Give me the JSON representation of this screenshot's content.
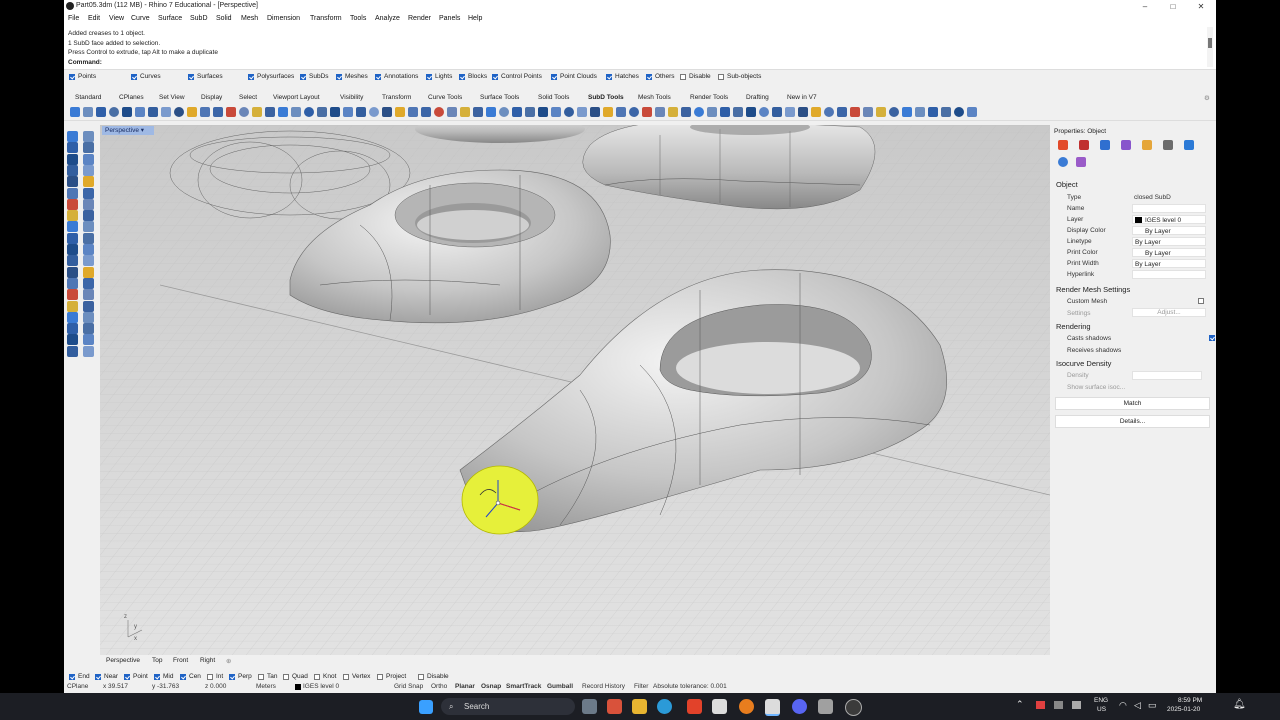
{
  "window": {
    "title": "Part05.3dm (112 MB) - Rhino 7 Educational - [Perspective]",
    "minimize": "–",
    "maximize": "□",
    "close": "✕"
  },
  "menu": [
    "File",
    "Edit",
    "View",
    "Curve",
    "Surface",
    "SubD",
    "Solid",
    "Mesh",
    "Dimension",
    "Transform",
    "Tools",
    "Analyze",
    "Render",
    "Panels",
    "Help"
  ],
  "command_history": [
    "Added creases to 1 object.",
    "1 SubD face added to selection.",
    "Press Control to extrude, tap Alt to make a duplicate"
  ],
  "command_prompt": "Command:",
  "filters": [
    {
      "label": "Points",
      "checked": true
    },
    {
      "label": "Curves",
      "checked": true
    },
    {
      "label": "Surfaces",
      "checked": true
    },
    {
      "label": "Polysurfaces",
      "checked": true
    },
    {
      "label": "SubDs",
      "checked": true
    },
    {
      "label": "Meshes",
      "checked": true
    },
    {
      "label": "Annotations",
      "checked": true
    },
    {
      "label": "Lights",
      "checked": true
    },
    {
      "label": "Blocks",
      "checked": true
    },
    {
      "label": "Control Points",
      "checked": true
    },
    {
      "label": "Point Clouds",
      "checked": true
    },
    {
      "label": "Hatches",
      "checked": true
    },
    {
      "label": "Others",
      "checked": true
    },
    {
      "label": "Disable",
      "checked": false
    },
    {
      "label": "Sub-objects",
      "checked": false
    }
  ],
  "toolbar_tabs": [
    "Standard",
    "CPlanes",
    "Set View",
    "Display",
    "Select",
    "Viewport Layout",
    "Visibility",
    "Transform",
    "Curve Tools",
    "Surface Tools",
    "Solid Tools",
    "SubD Tools",
    "Mesh Tools",
    "Render Tools",
    "Drafting",
    "New in V7"
  ],
  "viewport": {
    "label": "Perspective",
    "bottom_tabs": [
      "Perspective",
      "Top",
      "Front",
      "Right"
    ],
    "add_tab": "⊕",
    "axis": {
      "x": "x",
      "y": "y",
      "z": "z"
    }
  },
  "properties": {
    "title": "Properties: Object",
    "object_section": "Object",
    "rows": [
      {
        "label": "Type",
        "value": "closed SubD"
      },
      {
        "label": "Name",
        "value": ""
      },
      {
        "label": "Layer",
        "value": "IGES level 0"
      },
      {
        "label": "Display Color",
        "value": "By Layer"
      },
      {
        "label": "Linetype",
        "value": "By Layer"
      },
      {
        "label": "Print Color",
        "value": "By Layer"
      },
      {
        "label": "Print Width",
        "value": "By Layer"
      },
      {
        "label": "Hyperlink",
        "value": ""
      }
    ],
    "render_mesh_section": "Render Mesh Settings",
    "custom_mesh": "Custom Mesh",
    "settings": "Settings",
    "adjust_button": "Adjust...",
    "rendering_section": "Rendering",
    "casts_shadows": "Casts shadows",
    "receives_shadows": "Receives shadows",
    "isocurve_section": "Isocurve Density",
    "density": "Density",
    "show_surface_iso": "Show surface isoc...",
    "match_button": "Match",
    "details_button": "Details..."
  },
  "osnaps": [
    {
      "label": "End",
      "checked": true
    },
    {
      "label": "Near",
      "checked": true
    },
    {
      "label": "Point",
      "checked": true
    },
    {
      "label": "Mid",
      "checked": true
    },
    {
      "label": "Cen",
      "checked": true
    },
    {
      "label": "Int",
      "checked": false
    },
    {
      "label": "Perp",
      "checked": true
    },
    {
      "label": "Tan",
      "checked": false
    },
    {
      "label": "Quad",
      "checked": false
    },
    {
      "label": "Knot",
      "checked": false
    },
    {
      "label": "Vertex",
      "checked": false
    },
    {
      "label": "Project",
      "checked": false
    },
    {
      "label": "Disable",
      "checked": false
    }
  ],
  "status": {
    "cplane": "CPlane",
    "x": "x 39.517",
    "y": "y -31.763",
    "z": "z 0.000",
    "units": "Meters",
    "layer": "IGES level 0",
    "items": [
      "Grid Snap",
      "Ortho",
      "Planar",
      "Osnap",
      "SmartTrack",
      "Gumball",
      "Record History",
      "Filter"
    ],
    "tolerance": "Absolute tolerance: 0.001"
  },
  "taskbar": {
    "search": "Search",
    "lang_top": "ENG",
    "lang_bottom": "US",
    "time": "8:59 PM",
    "date": "2025-01-20"
  },
  "colors": {
    "accent": "#1f63c6",
    "selection_yellow": "#e6f03a",
    "viewport_tab": "#9fb9e4"
  }
}
